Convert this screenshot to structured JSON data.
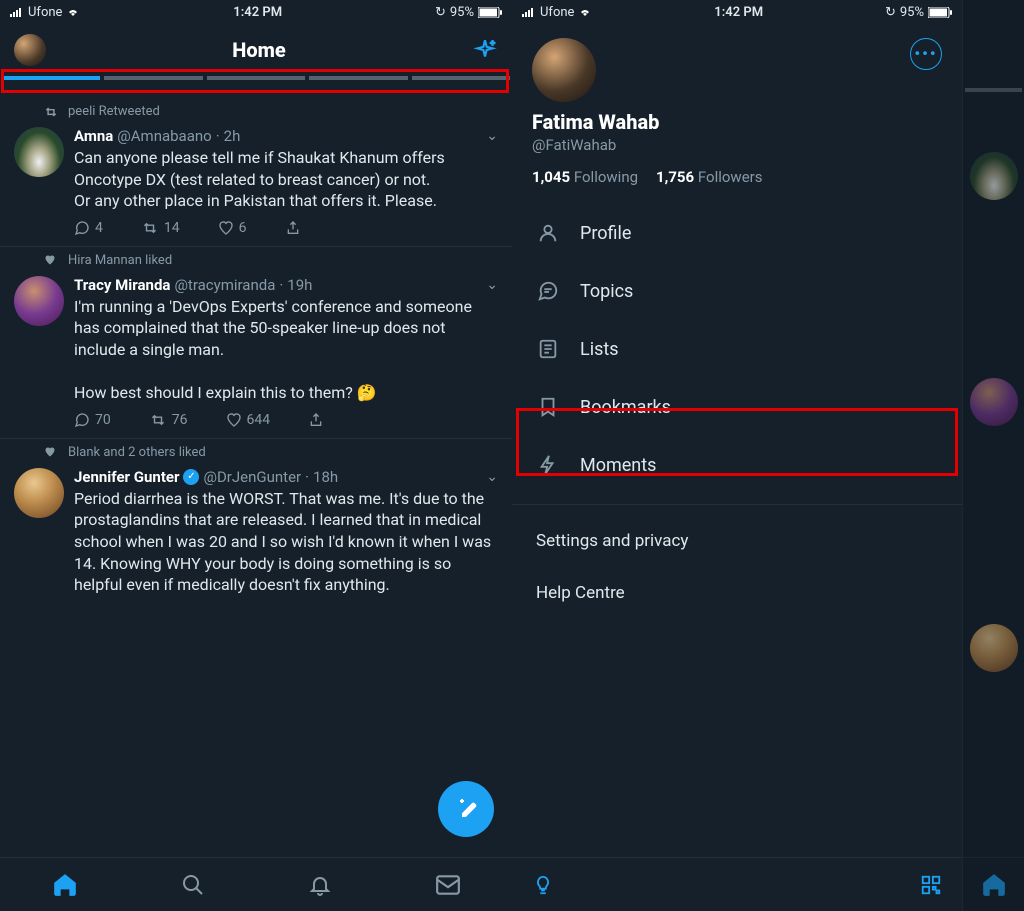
{
  "status_bar": {
    "carrier": "Ufone",
    "time": "1:42 PM",
    "battery": "95%"
  },
  "home": {
    "title": "Home"
  },
  "tweets": [
    {
      "context_icon": "retweet",
      "context": "peeli Retweeted",
      "name": "Amna",
      "handle": "@Amnabaano",
      "time": "2h",
      "text": "Can anyone please tell me if Shaukat Khanum offers Oncotype DX (test related to breast cancer) or not.\nOr any other place in Pakistan that offers it. Please.",
      "replies": "4",
      "retweets": "14",
      "likes": "6"
    },
    {
      "context_icon": "like",
      "context": "Hira Mannan liked",
      "name": "Tracy Miranda",
      "handle": "@tracymiranda",
      "time": "19h",
      "text": "I'm running a 'DevOps Experts' conference and someone has complained that the 50-speaker line-up does not include a single man.\n\nHow best should I explain this to them? 🤔",
      "replies": "70",
      "retweets": "76",
      "likes": "644"
    },
    {
      "context_icon": "like",
      "context": "Blank and 2 others liked",
      "name": "Jennifer Gunter",
      "verified": true,
      "handle": "@DrJenGunter",
      "time": "18h",
      "text": "Period diarrhea is the WORST. That was me. It's due to the prostaglandins that are released. I learned that in medical school when I was 20 and I so wish I'd known it when I was 14. Knowing WHY your body is doing something is so helpful even if medically doesn't fix anything."
    }
  ],
  "drawer": {
    "name": "Fatima Wahab",
    "handle": "@FatiWahab",
    "following_count": "1,045",
    "following_label": "Following",
    "followers_count": "1,756",
    "followers_label": "Followers",
    "items": [
      {
        "icon": "profile",
        "label": "Profile"
      },
      {
        "icon": "topics",
        "label": "Topics"
      },
      {
        "icon": "lists",
        "label": "Lists"
      },
      {
        "icon": "bookmark",
        "label": "Bookmarks"
      },
      {
        "icon": "moments",
        "label": "Moments"
      }
    ],
    "footer": {
      "settings": "Settings and privacy",
      "help": "Help Centre"
    }
  }
}
